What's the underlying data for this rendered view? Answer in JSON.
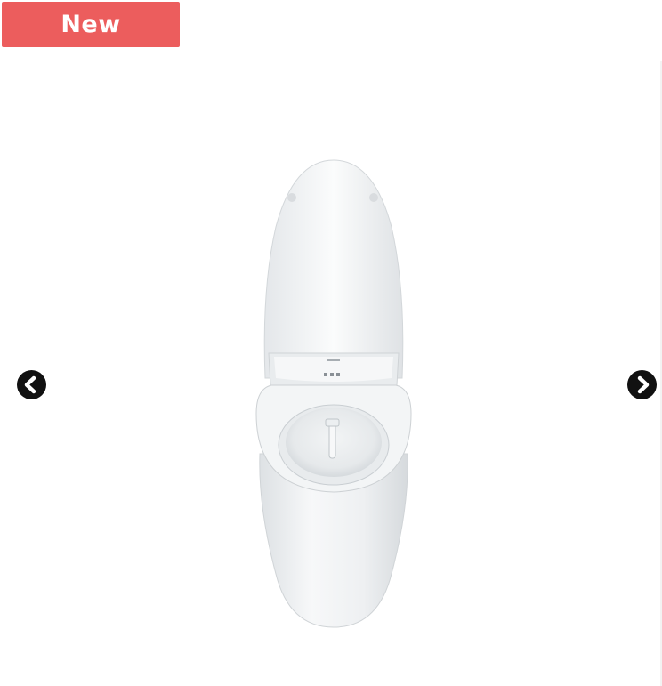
{
  "badge": {
    "label": "New",
    "color": "#ec5d5d"
  },
  "gallery": {
    "image": "smart-toilet-top-view",
    "prev_icon": "chevron-left-icon",
    "next_icon": "chevron-right-icon"
  }
}
